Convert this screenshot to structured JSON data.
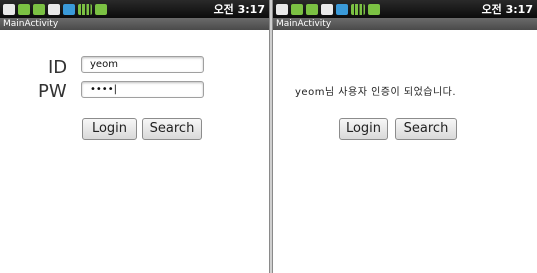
{
  "status_bar": {
    "time_left": "오전 3:17",
    "time_right": "오전 3:17"
  },
  "app": {
    "title": "MainActivity"
  },
  "login_screen": {
    "id_label": "ID",
    "pw_label": "PW",
    "id_value": "yeom",
    "pw_value": "••••|",
    "login_button": "Login",
    "search_button": "Search"
  },
  "result_screen": {
    "message": "yeom님 사용자 인증이 되었습니다.",
    "login_button": "Login",
    "search_button": "Search"
  },
  "colors": {
    "statusbar": "#111111",
    "titlebar": "#5a5a5a"
  }
}
